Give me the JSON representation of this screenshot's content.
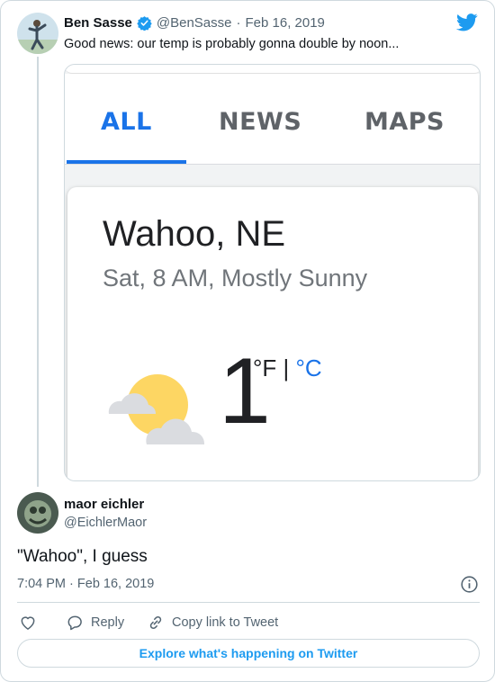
{
  "quoted_tweet": {
    "author_name": "Ben Sasse",
    "handle": "@BenSasse",
    "separator": "·",
    "date": "Feb 16, 2019",
    "text": "Good news: our temp is probably gonna double by noon..."
  },
  "embedded_screenshot": {
    "tabs": [
      "ALL",
      "NEWS",
      "MAPS"
    ],
    "active_tab": "ALL",
    "location": "Wahoo, NE",
    "conditions": "Sat, 8 AM, Mostly Sunny",
    "temperature": "1",
    "unit_f": "°F",
    "unit_sep": "|",
    "unit_c": "°C"
  },
  "tweet": {
    "author_name": "maor eichler",
    "handle": "@EichlerMaor",
    "text": "\"Wahoo\", I guess",
    "time": "7:04 PM",
    "separator": "·",
    "date": "Feb 16, 2019"
  },
  "actions": {
    "reply_label": "Reply",
    "copy_link_label": "Copy link to Tweet"
  },
  "explore_label": "Explore what's happening on Twitter",
  "colors": {
    "twitter_blue": "#1d9bf0",
    "google_blue": "#1a73e8",
    "verified_blue": "#1d9bf0",
    "muted": "#536471"
  }
}
